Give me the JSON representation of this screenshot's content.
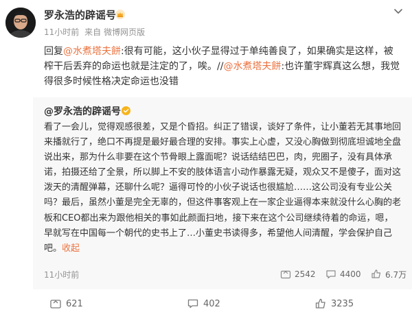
{
  "post": {
    "author": "罗永浩的辟谣号",
    "time": "11小时前",
    "source_prefix": "来自",
    "source": "微博网页版",
    "reply": {
      "prefix": "回复",
      "mention1": "@水煮塔夫餅",
      "text1": ":很有可能，这小伙子显得过于单纯善良了，如果确实是这样，被榨干后丢弃的命运也就是注定的了，唉。//",
      "mention2": "@水煮塔夫餅",
      "text2": ":也许董宇辉真这么想，我觉得很多时候性格决定命运也没错"
    }
  },
  "repost": {
    "author": "@罗永浩的辟谣号",
    "text": "看了一会儿，觉得观感很差，又是个昏招。纠正了错误，谈好了条件，让小董若无其事地回来播就行了，绝口不再提是最好最合理的安排。事实上心虚，又没心胸做到彻底坦诚地全盘说出来，那为什么非要在这个节骨眼上露面呢？说话结结巴巴，肉，兜圈子，没有具体承诺，拍摄还给了全景，所以脚上不安的肢体语言小动作暴露无疑，观众又不是傻子，面对这泼天的清醒弹幕，还聊什么呢？逼得可怜的小伙子说话也很尴尬……这公司没有专业公关吗？最后，虽然小董是完全无辜的，但这件事客观上在一家企业逼得本来就没什么心胸的老板和CEO都出来为跟他相关的事如此颜面扫地，接下来在这个公司继续待着的命运，嗯，早就写在中国每一个朝代的史书上了…小董史书读得多，希望他人间清醒，学会保护自己吧。",
    "collapse": "收起",
    "time": "11小时前",
    "reposts": "2542",
    "comments": "4400",
    "likes": "6.7万"
  },
  "actions": {
    "reposts": "621",
    "comments": "402",
    "likes": "3235"
  },
  "colors": {
    "mention": "#eb7340",
    "meta": "#939393",
    "box_bg": "#f8f8f8",
    "vip": "#f6a623"
  },
  "icons": [
    "more-icon",
    "vip-crown-icon",
    "verified-badge-icon",
    "repost-icon",
    "comment-icon",
    "like-icon"
  ]
}
